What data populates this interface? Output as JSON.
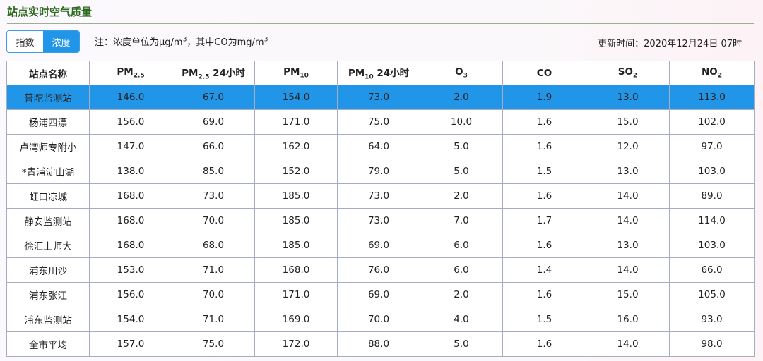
{
  "page": {
    "title": "站点实时空气质量",
    "toggle": {
      "index_label": "指数",
      "concentration_label": "浓度",
      "active": "concentration"
    },
    "note": {
      "prefix": "注：浓度单位为μg/m",
      "sup1": "3",
      "middle": "，其中CO为mg/m",
      "sup2": "3"
    },
    "update_time": "更新时间：2020年12月24日 07时"
  },
  "table": {
    "headers": [
      {
        "main": "站点名称",
        "sub": "",
        "suffix": ""
      },
      {
        "main": "PM",
        "sub": "2.5",
        "suffix": ""
      },
      {
        "main": "PM",
        "sub": "2.5",
        "suffix": " 24小时"
      },
      {
        "main": "PM",
        "sub": "10",
        "suffix": ""
      },
      {
        "main": "PM",
        "sub": "10",
        "suffix": " 24小时"
      },
      {
        "main": "O",
        "sub": "3",
        "suffix": ""
      },
      {
        "main": "CO",
        "sub": "",
        "suffix": ""
      },
      {
        "main": "SO",
        "sub": "2",
        "suffix": ""
      },
      {
        "main": "NO",
        "sub": "2",
        "suffix": ""
      }
    ],
    "selected_row": 0,
    "rows": [
      [
        "普陀监测站",
        "146.0",
        "67.0",
        "154.0",
        "73.0",
        "2.0",
        "1.9",
        "13.0",
        "113.0"
      ],
      [
        "杨浦四漂",
        "156.0",
        "69.0",
        "171.0",
        "75.0",
        "10.0",
        "1.6",
        "15.0",
        "102.0"
      ],
      [
        "卢湾师专附小",
        "147.0",
        "66.0",
        "162.0",
        "64.0",
        "5.0",
        "1.6",
        "12.0",
        "97.0"
      ],
      [
        "*青浦淀山湖",
        "138.0",
        "85.0",
        "152.0",
        "79.0",
        "5.0",
        "1.5",
        "13.0",
        "103.0"
      ],
      [
        "虹口凉城",
        "168.0",
        "73.0",
        "185.0",
        "73.0",
        "2.0",
        "1.6",
        "14.0",
        "89.0"
      ],
      [
        "静安监测站",
        "168.0",
        "70.0",
        "185.0",
        "73.0",
        "7.0",
        "1.7",
        "14.0",
        "114.0"
      ],
      [
        "徐汇上师大",
        "168.0",
        "68.0",
        "185.0",
        "69.0",
        "6.0",
        "1.6",
        "13.0",
        "103.0"
      ],
      [
        "浦东川沙",
        "153.0",
        "71.0",
        "168.0",
        "76.0",
        "6.0",
        "1.4",
        "14.0",
        "66.0"
      ],
      [
        "浦东张江",
        "156.0",
        "70.0",
        "171.0",
        "69.0",
        "2.0",
        "1.6",
        "15.0",
        "105.0"
      ],
      [
        "浦东监测站",
        "154.0",
        "71.0",
        "169.0",
        "70.0",
        "4.0",
        "1.5",
        "16.0",
        "93.0"
      ],
      [
        "全市平均",
        "157.0",
        "75.0",
        "172.0",
        "88.0",
        "5.0",
        "1.6",
        "14.0",
        "98.0"
      ]
    ]
  }
}
